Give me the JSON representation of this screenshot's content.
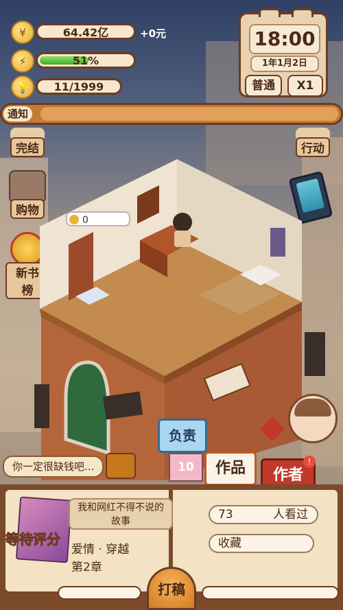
{
  "resources": {
    "money": "64.42亿",
    "money_delta": "+0元",
    "energy_text": "51%",
    "energy_level": 0.51,
    "ideas": "11/1999"
  },
  "clock": {
    "time": "18:00",
    "date": "1年1月2日",
    "mode": "普通",
    "speed": "X1"
  },
  "notice": {
    "label": "通知"
  },
  "side_left": [
    "完结",
    "购物",
    "新书榜"
  ],
  "side_right": [
    "行动"
  ],
  "room": {
    "coin_bubble": "0"
  },
  "dialog": "你一定很缺钱吧...",
  "tabs": {
    "responsible": "负责",
    "responsible_count": "10",
    "works": "作品",
    "author": "作者"
  },
  "book": {
    "status": "等待评分",
    "title_line1": "我和网红不得不说的",
    "title_line2": "故事",
    "genre": "爱情 · 穿越",
    "chapter": "第2章",
    "viewers": "73",
    "viewers_label": "人看过",
    "favorite": "收藏"
  },
  "action": {
    "type_label": "打稿"
  },
  "colors": {
    "frame": "#6c3b20",
    "parchment": "#f3e2c4",
    "accent": "#d17a22",
    "energy": "#3fae2a"
  }
}
